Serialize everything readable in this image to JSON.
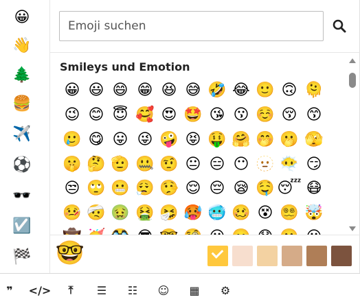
{
  "categories": [
    {
      "name": "smileys",
      "glyph": "😀"
    },
    {
      "name": "people",
      "glyph": "👋"
    },
    {
      "name": "nature",
      "glyph": "🌲"
    },
    {
      "name": "food",
      "glyph": "🍔"
    },
    {
      "name": "travel",
      "glyph": "✈️"
    },
    {
      "name": "activities",
      "glyph": "⚽"
    },
    {
      "name": "objects",
      "glyph": "🕶️"
    },
    {
      "name": "symbols",
      "glyph": "☑️"
    },
    {
      "name": "flags",
      "glyph": "🏁"
    }
  ],
  "search": {
    "placeholder": "Emoji suchen",
    "icon": "search-icon"
  },
  "section": {
    "title": "Smileys und Emotion"
  },
  "emojis": [
    [
      "😀",
      "😃",
      "😄",
      "😁",
      "😆",
      "😅",
      "🤣",
      "😂",
      "🙂",
      "🙃",
      "🫠"
    ],
    [
      "😉",
      "😊",
      "😇",
      "🥰",
      "😍",
      "🤩",
      "😘",
      "😗",
      "☺️",
      "😚",
      "😙"
    ],
    [
      "🥲",
      "😋",
      "😛",
      "😜",
      "🤪",
      "😝",
      "🤑",
      "🤗",
      "🤭",
      "🫢",
      "🫣"
    ],
    [
      "🤫",
      "🤔",
      "🫡",
      "🤐",
      "🤨",
      "😐",
      "😑",
      "😶",
      "🫥",
      "😶‍🌫️",
      "😏"
    ],
    [
      "😒",
      "🙄",
      "😬",
      "😮‍💨",
      "🤥",
      "😌",
      "😔",
      "😪",
      "🤤",
      "😴",
      "😷"
    ],
    [
      "🤒",
      "🤕",
      "🤢",
      "🤮",
      "🤧",
      "🥵",
      "🥶",
      "🥴",
      "😵",
      "😵‍💫",
      "🤯"
    ],
    [
      "🤠",
      "🥳",
      "🥸",
      "😎",
      "🤓",
      "🧐",
      "😕",
      "🫤",
      "😟",
      "🙁",
      "😮"
    ]
  ],
  "preview": {
    "glyph": "🤓"
  },
  "skin_tones": [
    {
      "name": "default",
      "color": "#ffc83d",
      "selected": true
    },
    {
      "name": "light",
      "color": "#f7dece",
      "selected": false
    },
    {
      "name": "medium-light",
      "color": "#f3d2a2",
      "selected": false
    },
    {
      "name": "medium",
      "color": "#d5ab88",
      "selected": false
    },
    {
      "name": "medium-dark",
      "color": "#af7e57",
      "selected": false
    },
    {
      "name": "dark",
      "color": "#7c533e",
      "selected": false
    }
  ],
  "toolbar": [
    {
      "name": "quote-icon",
      "glyph": "❞"
    },
    {
      "name": "code-icon",
      "glyph": "</>"
    },
    {
      "name": "upload-icon",
      "glyph": "⤒"
    },
    {
      "name": "bullet-list-icon",
      "glyph": "☰"
    },
    {
      "name": "numbered-list-icon",
      "glyph": "☷"
    },
    {
      "name": "emoji-icon",
      "glyph": "☺"
    },
    {
      "name": "calendar-icon",
      "glyph": "▦"
    },
    {
      "name": "gear-icon",
      "glyph": "⚙"
    }
  ]
}
